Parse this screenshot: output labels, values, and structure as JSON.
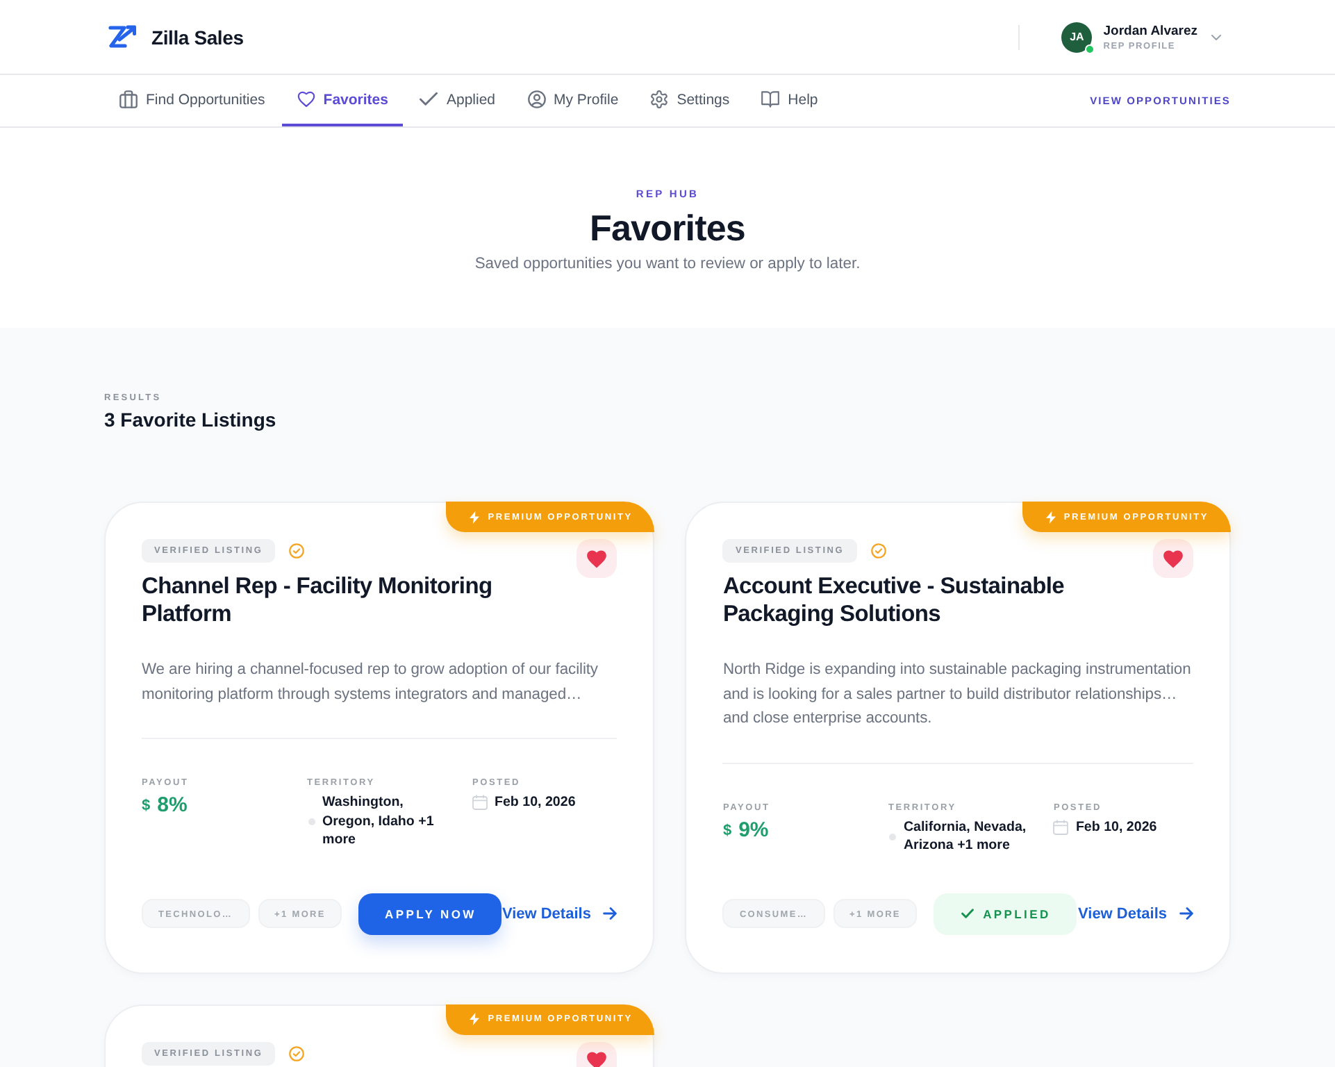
{
  "header": {
    "brand": "Zilla Sales",
    "user": {
      "initials": "JA",
      "name": "Jordan Alvarez",
      "role": "REP PROFILE",
      "online": true
    }
  },
  "nav": {
    "tabs": [
      {
        "label": "Find Opportunities",
        "selected": false
      },
      {
        "label": "Favorites",
        "selected": true
      },
      {
        "label": "Applied",
        "selected": false
      },
      {
        "label": "My Profile",
        "selected": false
      },
      {
        "label": "Settings",
        "selected": false
      },
      {
        "label": "Help",
        "selected": false
      }
    ],
    "link": "VIEW OPPORTUNITIES"
  },
  "hero": {
    "eyebrow": "REP HUB",
    "title": "Favorites",
    "subtitle": "Saved opportunities you want to review or apply to later."
  },
  "results": {
    "label": "RESULTS",
    "heading": "3 Favorite Listings"
  },
  "cards": [
    {
      "ribbon": "PREMIUM OPPORTUNITY",
      "badge": "VERIFIED LISTING",
      "favorited": true,
      "title": "Channel Rep - Facility Monitoring Platform",
      "description": "We are hiring a channel-focused rep to grow adoption of our facility monitoring platform through systems integrators and managed…",
      "payout": {
        "label": "PAYOUT",
        "currency": "$",
        "value": "8%"
      },
      "territory": {
        "label": "TERRITORY",
        "value": "Washington, Oregon, Idaho +1 more"
      },
      "posted": {
        "label": "POSTED",
        "value": "Feb 10, 2026"
      },
      "tags": [
        "TECHNOLO…",
        "+1 MORE"
      ],
      "action": {
        "kind": "apply",
        "label": "APPLY NOW"
      },
      "link": "View Details"
    },
    {
      "ribbon": "PREMIUM OPPORTUNITY",
      "badge": "VERIFIED LISTING",
      "favorited": true,
      "title": "Account Executive - Sustainable Packaging Solutions",
      "description": "North Ridge is expanding into sustainable packaging instrumentation and is looking for a sales partner to build distributor relationships… and close enterprise accounts.",
      "payout": {
        "label": "PAYOUT",
        "currency": "$",
        "value": "9%"
      },
      "territory": {
        "label": "TERRITORY",
        "value": "California, Nevada, Arizona +1 more"
      },
      "posted": {
        "label": "POSTED",
        "value": "Feb 10, 2026"
      },
      "tags": [
        "CONSUME…",
        "+1 MORE"
      ],
      "action": {
        "kind": "applied",
        "label": "APPLIED"
      },
      "link": "View Details"
    },
    {
      "ribbon": "PREMIUM OPPORTUNITY",
      "badge": "VERIFIED LISTING",
      "favorited": true
    }
  ]
}
